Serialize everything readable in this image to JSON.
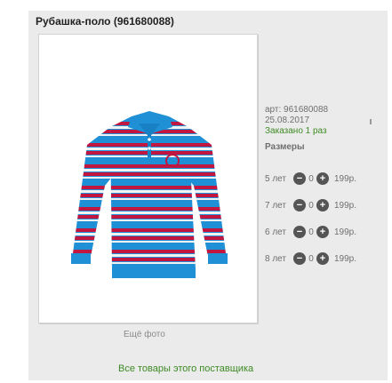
{
  "product": {
    "title": "Рубашка-поло (961680088)",
    "article": "арт: 961680088",
    "date": "25.08.2017",
    "ordered": "Заказано 1 раз",
    "sizes_title": "Размеры",
    "sizes": [
      {
        "label": "5 лет",
        "qty": "0",
        "price": "199р."
      },
      {
        "label": "7 лет",
        "qty": "0",
        "price": "199р."
      },
      {
        "label": "6 лет",
        "qty": "0",
        "price": "199р."
      },
      {
        "label": "8 лет",
        "qty": "0",
        "price": "199р."
      }
    ],
    "more_photo": "Ещё фото",
    "supplier_link": "Все товары этого поставщика"
  },
  "icons": {
    "minus": "minus-circle-icon",
    "plus": "plus-circle-icon"
  },
  "colors": {
    "green_text": "#3e8a24",
    "shirt_blue": "#1f8fd6",
    "stripe_red": "#c0163f",
    "stripe_white": "#f2f2f2"
  }
}
